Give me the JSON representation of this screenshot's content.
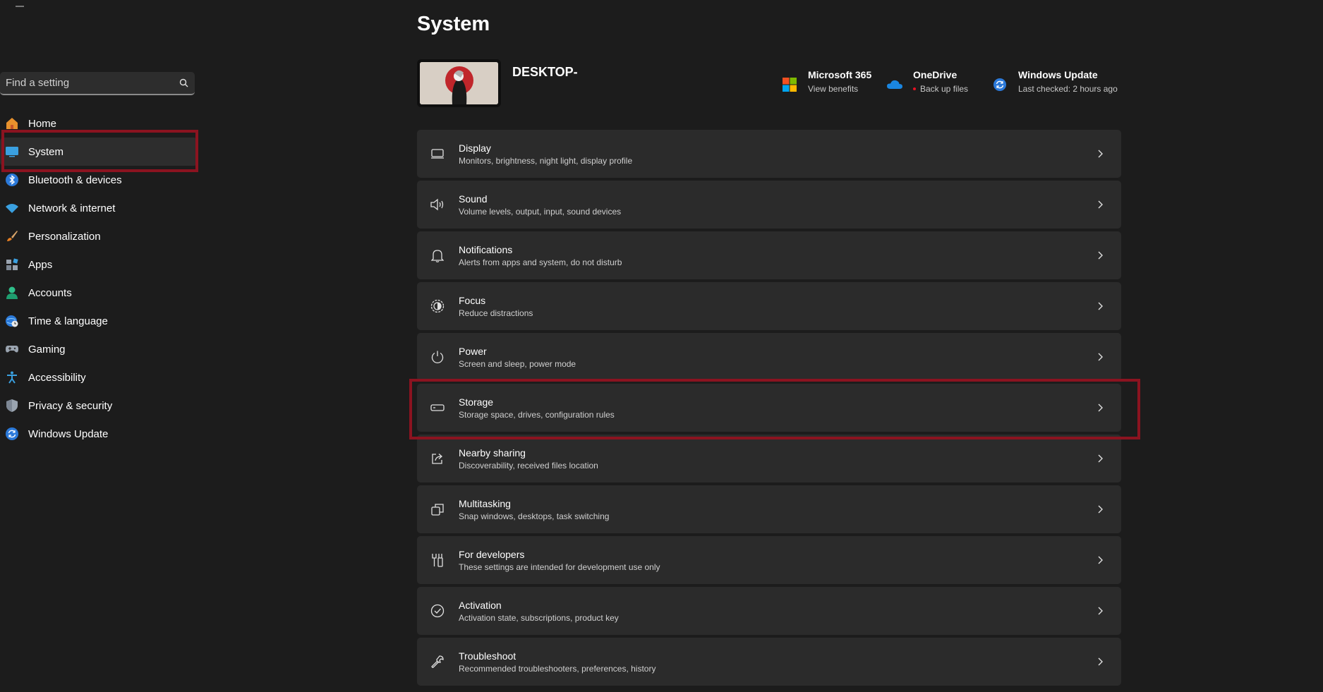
{
  "page": {
    "title": "System"
  },
  "search": {
    "placeholder": "Find a setting"
  },
  "sidebar": {
    "items": [
      {
        "label": "Home",
        "icon": "home-icon"
      },
      {
        "label": "System",
        "icon": "system-icon",
        "active": true
      },
      {
        "label": "Bluetooth & devices",
        "icon": "bluetooth-icon"
      },
      {
        "label": "Network & internet",
        "icon": "wifi-icon"
      },
      {
        "label": "Personalization",
        "icon": "brush-icon"
      },
      {
        "label": "Apps",
        "icon": "apps-icon"
      },
      {
        "label": "Accounts",
        "icon": "person-icon"
      },
      {
        "label": "Time & language",
        "icon": "globe-clock-icon"
      },
      {
        "label": "Gaming",
        "icon": "gamepad-icon"
      },
      {
        "label": "Accessibility",
        "icon": "accessibility-icon"
      },
      {
        "label": "Privacy & security",
        "icon": "shield-icon"
      },
      {
        "label": "Windows Update",
        "icon": "update-icon"
      }
    ]
  },
  "device": {
    "name": "DESKTOP-"
  },
  "quick_links": [
    {
      "title": "Microsoft 365",
      "sub": "View benefits",
      "icon": "microsoft-logo-icon"
    },
    {
      "title": "OneDrive",
      "sub": "Back up files",
      "icon": "cloud-icon"
    },
    {
      "title": "Windows Update",
      "sub": "Last checked: 2 hours ago",
      "icon": "update-icon"
    }
  ],
  "cards": [
    {
      "title": "Display",
      "sub": "Monitors, brightness, night light, display profile",
      "icon": "display-icon"
    },
    {
      "title": "Sound",
      "sub": "Volume levels, output, input, sound devices",
      "icon": "speaker-icon"
    },
    {
      "title": "Notifications",
      "sub": "Alerts from apps and system, do not disturb",
      "icon": "bell-icon"
    },
    {
      "title": "Focus",
      "sub": "Reduce distractions",
      "icon": "focus-icon"
    },
    {
      "title": "Power",
      "sub": "Screen and sleep, power mode",
      "icon": "power-icon"
    },
    {
      "title": "Storage",
      "sub": "Storage space, drives, configuration rules",
      "icon": "storage-icon"
    },
    {
      "title": "Nearby sharing",
      "sub": "Discoverability, received files location",
      "icon": "share-icon"
    },
    {
      "title": "Multitasking",
      "sub": "Snap windows, desktops, task switching",
      "icon": "multitask-icon"
    },
    {
      "title": "For developers",
      "sub": "These settings are intended for development use only",
      "icon": "developer-tools-icon"
    },
    {
      "title": "Activation",
      "sub": "Activation state, subscriptions, product key",
      "icon": "checkmark-circle-icon"
    },
    {
      "title": "Troubleshoot",
      "sub": "Recommended troubleshooters, preferences, history",
      "icon": "wrench-icon"
    }
  ],
  "colors": {
    "accent": "#0078d4",
    "highlight_box": "#8b1320",
    "card_bg": "#2b2b2b",
    "page_bg": "#1c1c1c"
  }
}
